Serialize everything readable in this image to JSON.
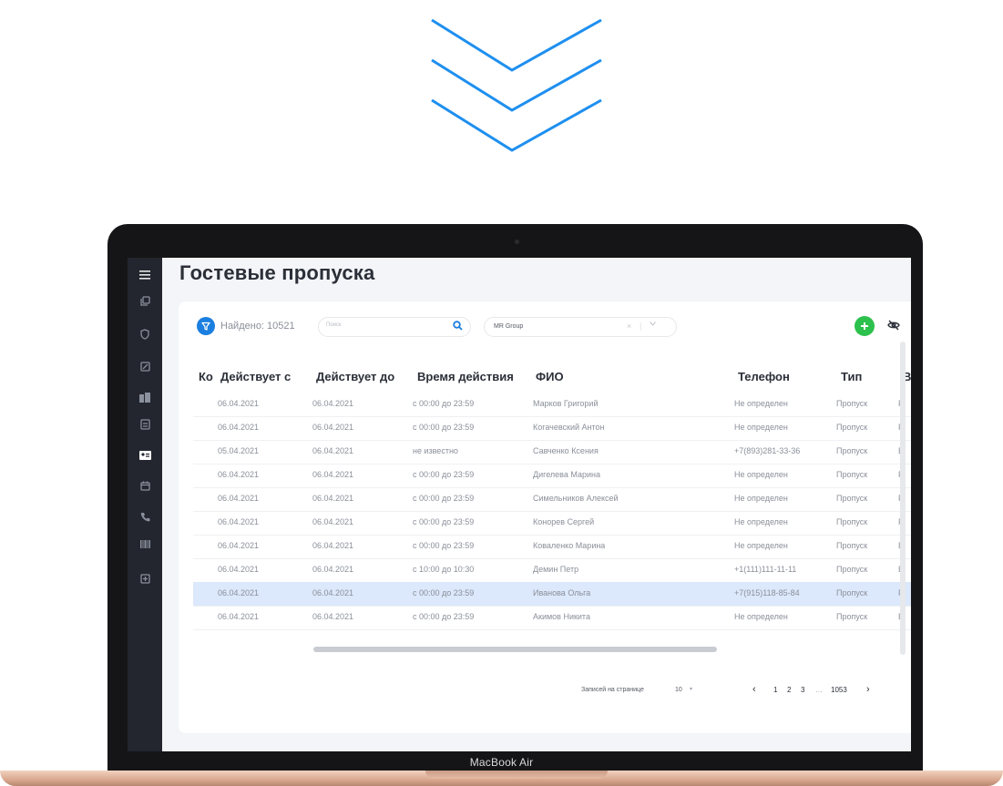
{
  "device": {
    "label": "MacBook Air"
  },
  "colors": {
    "accent": "#1a7fe0",
    "add": "#2cc14c",
    "selected_row": "#dce8fb",
    "sidebar": "#23262f"
  },
  "sidebar": {
    "items": [
      {
        "icon": "menu-icon"
      },
      {
        "icon": "copy-icon"
      },
      {
        "icon": "shield-icon"
      },
      {
        "icon": "edit-icon"
      },
      {
        "icon": "building-icon"
      },
      {
        "icon": "badge-icon"
      },
      {
        "icon": "guest-pass-icon",
        "active": true
      },
      {
        "icon": "calendar-icon"
      },
      {
        "icon": "phone-icon"
      },
      {
        "icon": "barcode-icon"
      },
      {
        "icon": "card-icon"
      }
    ]
  },
  "page": {
    "title": "Гостевые пропуска"
  },
  "toolbar": {
    "found_label": "Найдено: 10521",
    "search_placeholder": "Поиск",
    "company_value": "MR Group",
    "company_clear": "×",
    "company_sep": "|"
  },
  "table": {
    "columns": [
      "Ко",
      "Действует с",
      "Действует до",
      "Время действия",
      "ФИО",
      "Телефон",
      "Тип",
      "В"
    ],
    "rows": [
      [
        "06.04.2021",
        "06.04.2021",
        "с 00:00 до 23:59",
        "Марков Григорий",
        "Не определен",
        "Пропуск",
        "Р"
      ],
      [
        "06.04.2021",
        "06.04.2021",
        "с 00:00 до 23:59",
        "Когачевский Антон",
        "Не определен",
        "Пропуск",
        "Р"
      ],
      [
        "05.04.2021",
        "06.04.2021",
        "не известно",
        "Савченко Ксения",
        "+7(893)281-33-36",
        "Пропуск",
        "В"
      ],
      [
        "06.04.2021",
        "06.04.2021",
        "с 00:00 до 23:59",
        "Дигелева Марина",
        "Не определен",
        "Пропуск",
        "Р"
      ],
      [
        "06.04.2021",
        "06.04.2021",
        "с 00:00 до 23:59",
        "Симельников Алексей",
        "Не определен",
        "Пропуск",
        "Р"
      ],
      [
        "06.04.2021",
        "06.04.2021",
        "с 00:00 до 23:59",
        "Конорев Сергей",
        "Не определен",
        "Пропуск",
        "Р"
      ],
      [
        "06.04.2021",
        "06.04.2021",
        "с 00:00 до 23:59",
        "Коваленко Марина",
        "Не определен",
        "Пропуск",
        "В"
      ],
      [
        "06.04.2021",
        "06.04.2021",
        "с 10:00 до 10:30",
        "Демин Петр",
        "+1(111)111-11-11",
        "Пропуск",
        "В"
      ],
      [
        "06.04.2021",
        "06.04.2021",
        "с 00:00 до 23:59",
        "Иванова Ольга",
        "+7(915)118-85-84",
        "Пропуск",
        "Р"
      ],
      [
        "06.04.2021",
        "06.04.2021",
        "с 00:00 до 23:59",
        "Акимов Никита",
        "Не определен",
        "Пропуск",
        "В"
      ]
    ],
    "selected_row": 8
  },
  "pagination": {
    "per_page_label": "Записей на странице",
    "per_page_value": "10",
    "prev": "‹",
    "pages": [
      "1",
      "2",
      "3"
    ],
    "dots": "…",
    "last": "1053",
    "next": "›"
  }
}
